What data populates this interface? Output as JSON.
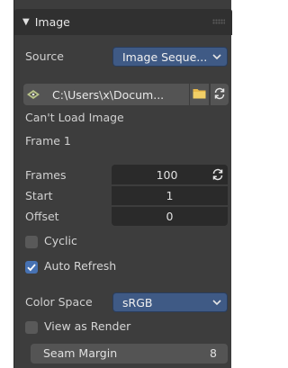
{
  "panel": {
    "title": "Image",
    "source_label": "Source",
    "source_value": "Image Seque...",
    "filepath": "C:\\Users\\x\\Docum...",
    "status_line1": "Can't Load Image",
    "status_line2": "Frame 1",
    "frames_label": "Frames",
    "frames_value": "100",
    "start_label": "Start",
    "start_value": "1",
    "offset_label": "Offset",
    "offset_value": "0",
    "cyclic_label": "Cyclic",
    "cyclic_checked": false,
    "auto_refresh_label": "Auto Refresh",
    "auto_refresh_checked": true,
    "color_space_label": "Color Space",
    "color_space_value": "sRGB",
    "view_as_render_label": "View as Render",
    "view_as_render_checked": false,
    "seam_margin_label": "Seam Margin",
    "seam_margin_value": "8"
  },
  "icons": {
    "collapse": "triangle-down-icon",
    "drag": "grip-icon",
    "text_icon": "image-texture-icon",
    "folder": "folder-icon",
    "reload": "reload-icon",
    "dropdown": "chevron-down-icon",
    "check": "checkmark-icon"
  },
  "colors": {
    "panel_bg": "#3d3d3d",
    "header_bg": "#303030",
    "dropdown_bg": "#3f5a85",
    "field_bg": "#2a2a2a",
    "button_bg": "#545454",
    "checkbox_on": "#4772b3",
    "folder": "#e8b94a"
  }
}
